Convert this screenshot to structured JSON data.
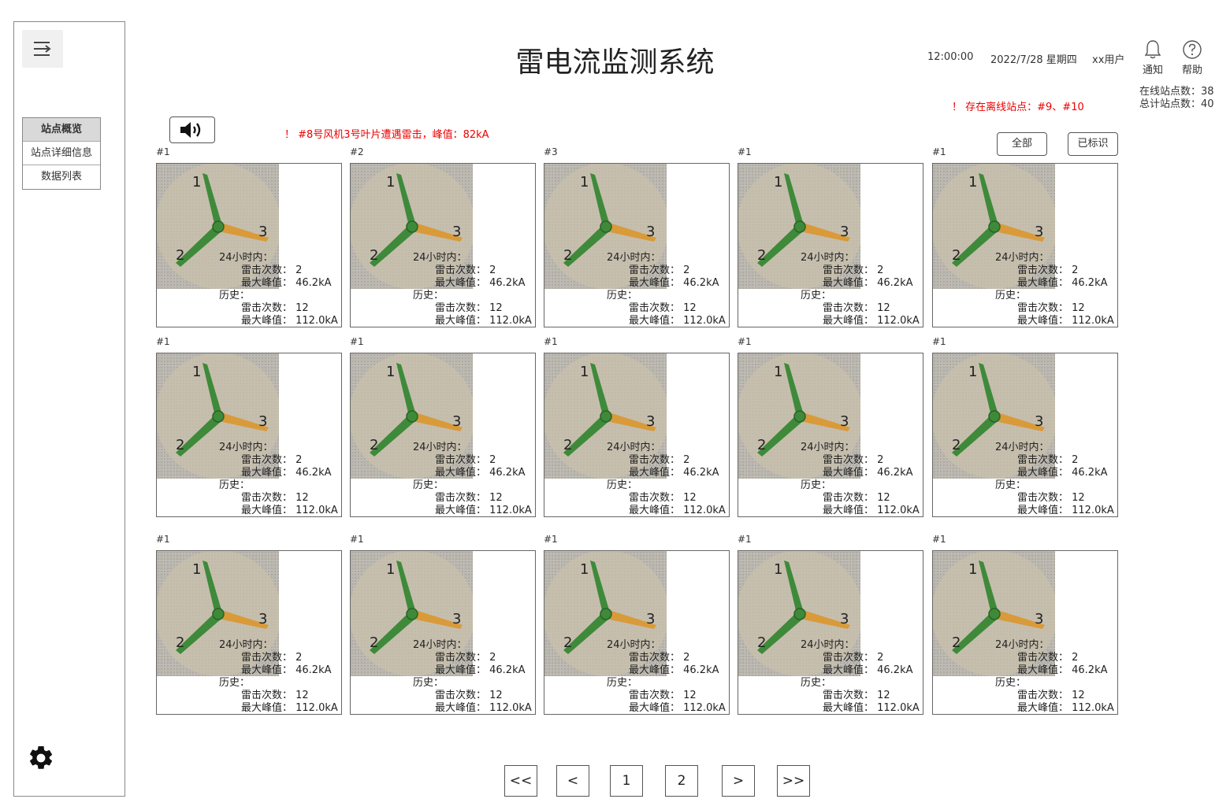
{
  "header": {
    "title": "雷电流监测系统",
    "time": "12:00:00",
    "date": "2022/7/28 星期四",
    "user": "xx用户",
    "notify_label": "通知",
    "help_label": "帮助",
    "online_label": "在线站点数：38",
    "total_label": "总计站点数：40"
  },
  "alerts": {
    "offline": "！ 存在离线站点：#9、#10",
    "lightning": "！ #8号风机3号叶片遭遇雷击，峰值：82kA"
  },
  "sidebar": {
    "items": [
      {
        "label": "站点概览",
        "active": true
      },
      {
        "label": "站点详细信息",
        "active": false
      },
      {
        "label": "数据列表",
        "active": false
      }
    ]
  },
  "filters": {
    "all_label": "全部",
    "marked_label": "已标识"
  },
  "card_text": {
    "h24": "24小时内：",
    "history": "历史："
  },
  "cards": [
    {
      "id": "#1",
      "blades": [
        "1",
        "2",
        "3"
      ],
      "h24_count": "雷击次数：  2",
      "h24_peak": "最大峰值：  46.2kA",
      "hist_count": "雷击次数：  12",
      "hist_peak": "最大峰值：  112.0kA"
    },
    {
      "id": "#2",
      "blades": [
        "1",
        "2",
        "3"
      ],
      "h24_count": "雷击次数：  2",
      "h24_peak": "最大峰值：  46.2kA",
      "hist_count": "雷击次数：  12",
      "hist_peak": "最大峰值：  112.0kA"
    },
    {
      "id": "#3",
      "blades": [
        "1",
        "2",
        "3"
      ],
      "h24_count": "雷击次数：  2",
      "h24_peak": "最大峰值：  46.2kA",
      "hist_count": "雷击次数：  12",
      "hist_peak": "最大峰值：  112.0kA"
    },
    {
      "id": "#1",
      "blades": [
        "1",
        "2",
        "3"
      ],
      "h24_count": "雷击次数：  2",
      "h24_peak": "最大峰值：  46.2kA",
      "hist_count": "雷击次数：  12",
      "hist_peak": "最大峰值：  112.0kA"
    },
    {
      "id": "#1",
      "blades": [
        "1",
        "2",
        "3"
      ],
      "h24_count": "雷击次数：  2",
      "h24_peak": "最大峰值：  46.2kA",
      "hist_count": "雷击次数：  12",
      "hist_peak": "最大峰值：  112.0kA"
    },
    {
      "id": "#1",
      "blades": [
        "1",
        "2",
        "3"
      ],
      "h24_count": "雷击次数：  2",
      "h24_peak": "最大峰值：  46.2kA",
      "hist_count": "雷击次数：  12",
      "hist_peak": "最大峰值：  112.0kA"
    },
    {
      "id": "#1",
      "blades": [
        "1",
        "2",
        "3"
      ],
      "h24_count": "雷击次数：  2",
      "h24_peak": "最大峰值：  46.2kA",
      "hist_count": "雷击次数：  12",
      "hist_peak": "最大峰值：  112.0kA"
    },
    {
      "id": "#1",
      "blades": [
        "1",
        "2",
        "3"
      ],
      "h24_count": "雷击次数：  2",
      "h24_peak": "最大峰值：  46.2kA",
      "hist_count": "雷击次数：  12",
      "hist_peak": "最大峰值：  112.0kA"
    },
    {
      "id": "#1",
      "blades": [
        "1",
        "2",
        "3"
      ],
      "h24_count": "雷击次数：  2",
      "h24_peak": "最大峰值：  46.2kA",
      "hist_count": "雷击次数：  12",
      "hist_peak": "最大峰值：  112.0kA"
    },
    {
      "id": "#1",
      "blades": [
        "1",
        "2",
        "3"
      ],
      "h24_count": "雷击次数：  2",
      "h24_peak": "最大峰值：  46.2kA",
      "hist_count": "雷击次数：  12",
      "hist_peak": "最大峰值：  112.0kA"
    },
    {
      "id": "#1",
      "blades": [
        "1",
        "2",
        "3"
      ],
      "h24_count": "雷击次数：  2",
      "h24_peak": "最大峰值：  46.2kA",
      "hist_count": "雷击次数：  12",
      "hist_peak": "最大峰值：  112.0kA"
    },
    {
      "id": "#1",
      "blades": [
        "1",
        "2",
        "3"
      ],
      "h24_count": "雷击次数：  2",
      "h24_peak": "最大峰值：  46.2kA",
      "hist_count": "雷击次数：  12",
      "hist_peak": "最大峰值：  112.0kA"
    },
    {
      "id": "#1",
      "blades": [
        "1",
        "2",
        "3"
      ],
      "h24_count": "雷击次数：  2",
      "h24_peak": "最大峰值：  46.2kA",
      "hist_count": "雷击次数：  12",
      "hist_peak": "最大峰值：  112.0kA"
    },
    {
      "id": "#1",
      "blades": [
        "1",
        "2",
        "3"
      ],
      "h24_count": "雷击次数：  2",
      "h24_peak": "最大峰值：  46.2kA",
      "hist_count": "雷击次数：  12",
      "hist_peak": "最大峰值：  112.0kA"
    },
    {
      "id": "#1",
      "blades": [
        "1",
        "2",
        "3"
      ],
      "h24_count": "雷击次数：  2",
      "h24_peak": "最大峰值：  46.2kA",
      "hist_count": "雷击次数：  12",
      "hist_peak": "最大峰值：  112.0kA"
    }
  ],
  "pagination": [
    {
      "label": "<<"
    },
    {
      "label": "<"
    },
    {
      "label": "1"
    },
    {
      "label": "2"
    },
    {
      "label": ">"
    },
    {
      "label": ">>"
    }
  ],
  "colors": {
    "alert": "#ee0000",
    "blade_normal": "#3e8a3a",
    "blade_struck": "#d99a3a",
    "hub_disc": "#c9c0ac"
  },
  "icons": {
    "menu": "menu-collapse-icon",
    "sound": "speaker-icon",
    "notify": "bell-icon",
    "help": "help-circle-icon",
    "settings": "gear-icon"
  }
}
